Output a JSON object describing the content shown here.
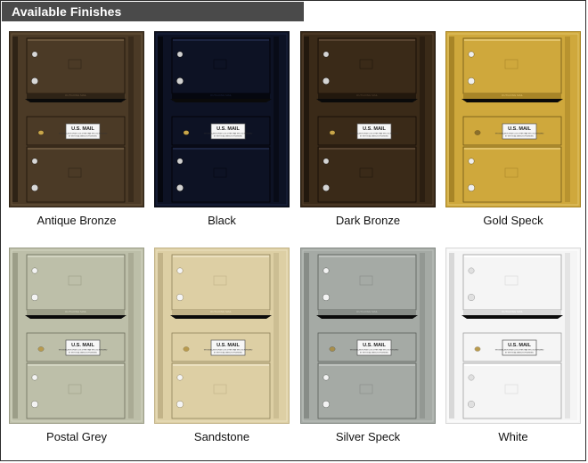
{
  "header": {
    "title": "Available Finishes"
  },
  "plate": {
    "line1": "U.S. MAIL",
    "line2": "THE INSTALLATION OF ANY LOCK OTHER THAN THE LOCK FURNISHED",
    "line3": "BY THE POSTAL SERVICE IS PROHIBITED",
    "hinge_label": "OUTGOING MAIL"
  },
  "finishes": [
    {
      "name": "Antique Bronze",
      "color": "#4b3a26",
      "dark": "#2e2316",
      "light": "#6a563d",
      "shadow": "#1c140b",
      "knob": "#d8d8d8",
      "lock": "#c9a64a"
    },
    {
      "name": "Black",
      "color": "#0d1224",
      "dark": "#05070f",
      "light": "#1c2440",
      "shadow": "#000000",
      "knob": "#d0d0d0",
      "lock": "#c9a64a"
    },
    {
      "name": "Dark Bronze",
      "color": "#3a2a18",
      "dark": "#22180d",
      "light": "#574330",
      "shadow": "#120b05",
      "knob": "#d4d4d4",
      "lock": "#c9a64a"
    },
    {
      "name": "Gold Speck",
      "color": "#cfa83c",
      "dark": "#a88527",
      "light": "#e2c36a",
      "shadow": "#6e5617",
      "knob": "#efefef",
      "lock": "#8a6f2c"
    },
    {
      "name": "Postal Grey",
      "color": "#bdbfa9",
      "dark": "#9c9e88",
      "light": "#d2d4c1",
      "shadow": "#6d6f5d",
      "knob": "#f3f3f3",
      "lock": "#b89a4e"
    },
    {
      "name": "Sandstone",
      "color": "#ddcfa4",
      "dark": "#c2b388",
      "light": "#ebe0bf",
      "shadow": "#8e805b",
      "knob": "#f5f5f5",
      "lock": "#b89a4e"
    },
    {
      "name": "Silver Speck",
      "color": "#a5aaa5",
      "dark": "#878c87",
      "light": "#bdc1bd",
      "shadow": "#5a5e5a",
      "knob": "#f3f3f3",
      "lock": "#a88e4a"
    },
    {
      "name": "White",
      "color": "#f5f5f5",
      "dark": "#d8d8d8",
      "light": "#ffffff",
      "shadow": "#a0a0a0",
      "knob": "#e0e0e0",
      "lock": "#b89a4e"
    }
  ]
}
